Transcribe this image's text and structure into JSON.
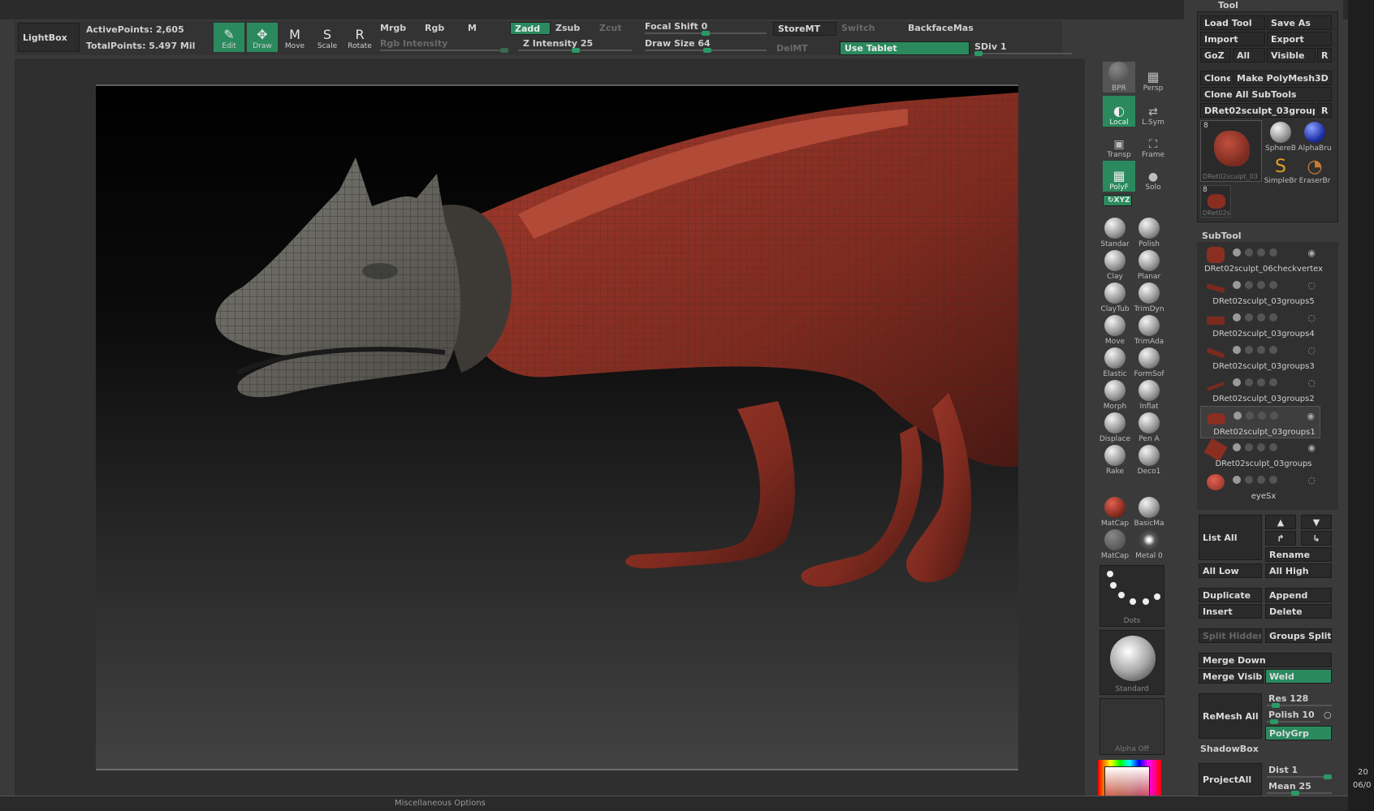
{
  "topbar": {
    "lightbox": "LightBox",
    "active_points": "ActivePoints: 2,605",
    "total_points": "TotalPoints: 5.497 Mil",
    "tools": [
      {
        "label": "Edit",
        "glyph": "✎",
        "active": true
      },
      {
        "label": "Draw",
        "glyph": "✥",
        "active": true
      },
      {
        "label": "Move",
        "glyph": "M",
        "active": false
      },
      {
        "label": "Scale",
        "glyph": "S",
        "active": false
      },
      {
        "label": "Rotate",
        "glyph": "R",
        "active": false
      }
    ],
    "mrgb": "Mrgb",
    "rgb": "Rgb",
    "m": "M",
    "rgb_intensity": "Rgb Intensity",
    "zadd": "Zadd",
    "zsub": "Zsub",
    "zcut": "Zcut",
    "z_intensity": "Z Intensity 25",
    "focal_shift": "Focal Shift 0",
    "draw_size": "Draw Size 64",
    "storemt": "StoreMT",
    "delmt": "DelMT",
    "switch": "Switch",
    "use_tablet": "Use Tablet",
    "backface": "BackfaceMas",
    "sdiv": "SDiv 1"
  },
  "right_shelf": {
    "bpr": "BPR",
    "persp": "Persp",
    "local": "Local",
    "lsym": "L.Sym",
    "transp": "Transp",
    "frame": "Frame",
    "polyf": "PolyF",
    "solo": "Solo",
    "xyz": "↻XYZ",
    "brushes": [
      "Standar",
      "Polish",
      "Clay",
      "Planar",
      "ClayTub",
      "TrimDyn",
      "Move",
      "TrimAda",
      "Elastic",
      "FormSof",
      "Morph",
      "Inflat",
      "Displace",
      "Pen A",
      "Rake",
      "Deco1"
    ],
    "materials": [
      "MatCap",
      "BasicMa",
      "MatCap",
      "Metal 0"
    ],
    "stroke": "Dots",
    "alpha_brush": "Standard",
    "alpha": "Alpha Off"
  },
  "tool_panel": {
    "title": "Tool",
    "load_tool": "Load Tool",
    "save_as": "Save As",
    "import": "Import",
    "export": "Export",
    "goz": "GoZ",
    "all": "All",
    "visible": "Visible",
    "r": "R",
    "clone": "Clone",
    "make_polymesh": "Make PolyMesh3D",
    "clone_all": "Clone All SubTools",
    "current_tool": "DRet02sculpt_03group",
    "tool_count": "8",
    "tool_count2": "8",
    "thumb_label": "DRet02sculpt_03",
    "thumb_label2": "DRet02s",
    "brushes": [
      "SphereB",
      "AlphaBru",
      "SimpleBr",
      "EraserBr"
    ],
    "subtool_header": "SubTool",
    "subtools": [
      "DRet02sculpt_06checkvertex",
      "DRet02sculpt_03groups5",
      "DRet02sculpt_03groups4",
      "DRet02sculpt_03groups3",
      "DRet02sculpt_03groups2",
      "DRet02sculpt_03groups1",
      "DRet02sculpt_03groups",
      "eyeSx"
    ],
    "list_all": "List All",
    "rename": "Rename",
    "all_low": "All Low",
    "all_high": "All High",
    "duplicate": "Duplicate",
    "append": "Append",
    "insert": "Insert",
    "delete": "Delete",
    "split_hidden": "Split Hidden",
    "groups_split": "Groups Split",
    "merge_down": "Merge Down",
    "merge_visible": "Merge Visible",
    "weld": "Weld",
    "remesh_all": "ReMesh All",
    "res": "Res 128",
    "polish": "Polish 10",
    "polygrp": "PolyGrp",
    "shadowbox": "ShadowBox",
    "project_all": "ProjectAll",
    "dist": "Dist 1",
    "mean": "Mean 25"
  },
  "bottom": {
    "menu": "Miscellaneous Options",
    "time": "20",
    "date": "06/0"
  },
  "colors": {
    "accent": "#2a8a5e",
    "model": "#8a2e22"
  }
}
